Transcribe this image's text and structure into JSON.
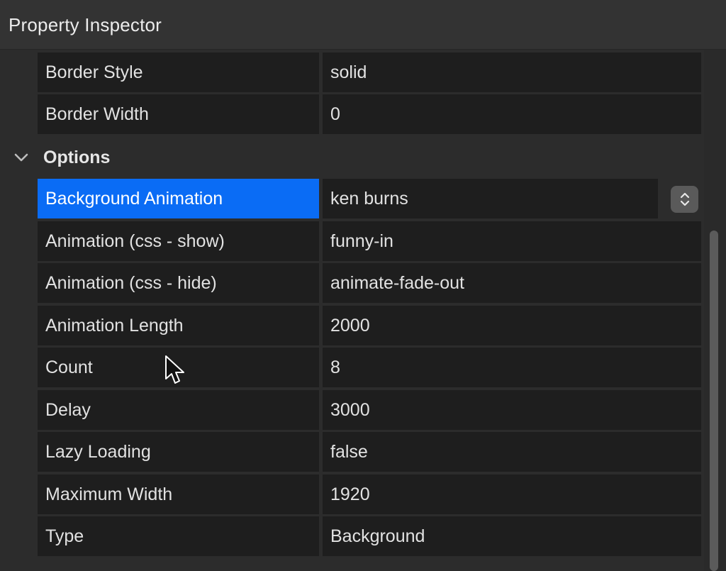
{
  "window": {
    "title": "Property Inspector"
  },
  "rows_top": [
    {
      "label": "Border Style",
      "value": "solid"
    },
    {
      "label": "Border Width",
      "value": "0"
    }
  ],
  "section": {
    "title": "Options",
    "expanded": true,
    "chevron_icon": "chevron-down-icon"
  },
  "rows_options": [
    {
      "label": "Background Animation",
      "value": "ken burns",
      "selected": true,
      "control_icon": "updown-stepper-icon"
    },
    {
      "label": "Animation (css - show)",
      "value": "funny-in"
    },
    {
      "label": "Animation (css - hide)",
      "value": "animate-fade-out"
    },
    {
      "label": "Animation Length",
      "value": "2000"
    },
    {
      "label": "Count",
      "value": "8"
    },
    {
      "label": "Delay",
      "value": "3000"
    },
    {
      "label": "Lazy Loading",
      "value": "false"
    },
    {
      "label": "Maximum Width",
      "value": "1920"
    },
    {
      "label": "Type",
      "value": "Background"
    }
  ],
  "colors": {
    "accent": "#0a6cf5",
    "panel_bg": "#2c2c2c",
    "cell_bg": "#1e1e1e",
    "titlebar_bg": "#333333"
  }
}
